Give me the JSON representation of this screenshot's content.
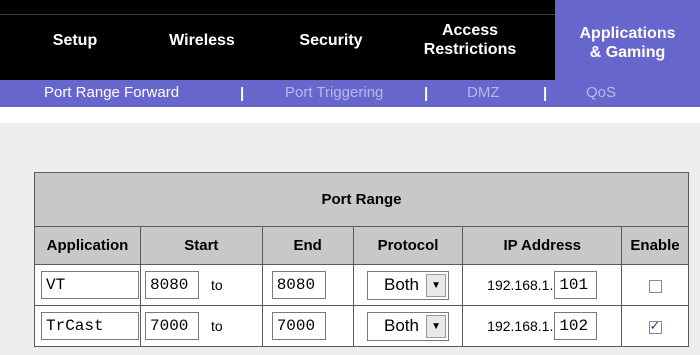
{
  "nav": {
    "tabs": [
      {
        "label": "Setup"
      },
      {
        "label": "Wireless"
      },
      {
        "label": "Security"
      },
      {
        "label_line1": "Access",
        "label_line2": "Restrictions"
      },
      {
        "label_line1": "Applications",
        "label_line2": "& Gaming",
        "active": true
      }
    ]
  },
  "subnav": {
    "items": [
      "Port Range Forward",
      "Port Triggering",
      "DMZ",
      "QoS"
    ],
    "separator": "|",
    "active": "Port Range Forward"
  },
  "table": {
    "title": "Port Range",
    "headers": [
      "Application",
      "Start",
      "End",
      "Protocol",
      "IP Address",
      "Enable"
    ],
    "ip_prefix": "192.168.1.",
    "to_label": "to",
    "rows": [
      {
        "application": "VT",
        "start": "8080",
        "end": "8080",
        "protocol": "Both",
        "ip_last": "101",
        "enabled": false
      },
      {
        "application": "TrCast",
        "start": "7000",
        "end": "7000",
        "protocol": "Both",
        "ip_last": "102",
        "enabled": true
      }
    ]
  },
  "colors": {
    "nav_bg": "#000000",
    "accent": "#6666cc",
    "content_bg": "#ededed",
    "header_cell_bg": "#c8c8c8"
  },
  "icons": {
    "dropdown": "chevron-down-icon",
    "checkbox_checked": "checkmark-icon"
  }
}
